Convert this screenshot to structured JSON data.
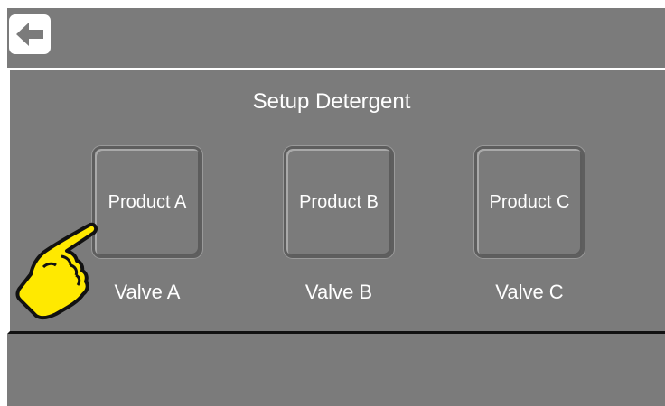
{
  "topbar": {
    "back_icon": "arrow-left-icon"
  },
  "page": {
    "title": "Setup Detergent"
  },
  "products": [
    {
      "label": "Product A",
      "valve": "Valve A"
    },
    {
      "label": "Product B",
      "valve": "Valve B"
    },
    {
      "label": "Product C",
      "valve": "Valve C"
    }
  ],
  "pointer": {
    "icon": "pointing-hand-icon",
    "color": "#ffe900"
  },
  "colors": {
    "panel": "#7b7b7b",
    "text": "#ffffff",
    "border_light": "#ffffff",
    "border_dark": "#111111"
  }
}
